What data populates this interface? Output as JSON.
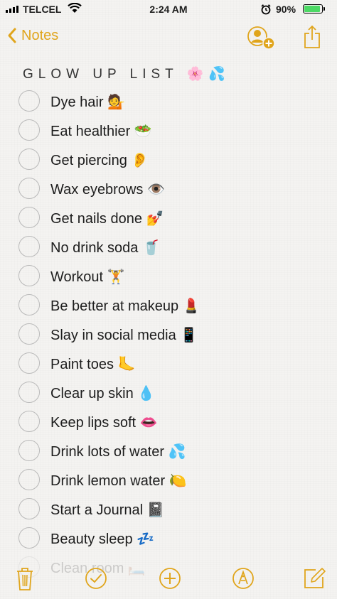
{
  "status_bar": {
    "carrier": "TELCEL",
    "time": "2:24 AM",
    "battery": "90%",
    "battery_level": 0.9
  },
  "nav": {
    "back_label": "Notes",
    "icons": [
      "chevron-left-icon",
      "add-people-icon",
      "share-icon"
    ]
  },
  "note": {
    "title": "GLOW UP LIST 🌸💦",
    "items": [
      {
        "text": "Dye hair 💁"
      },
      {
        "text": "Eat healthier 🥗"
      },
      {
        "text": "Get piercing 👂"
      },
      {
        "text": "Wax eyebrows 👁️"
      },
      {
        "text": "Get nails done 💅"
      },
      {
        "text": "No drink soda 🥤"
      },
      {
        "text": "Workout 🏋️"
      },
      {
        "text": "Be better at makeup 💄"
      },
      {
        "text": "Slay in social media 📱"
      },
      {
        "text": "Paint toes 🦶"
      },
      {
        "text": "Clear up skin 💧"
      },
      {
        "text": "Keep lips soft 👄"
      },
      {
        "text": "Drink lots of water 💦"
      },
      {
        "text": "Drink lemon water 🍋"
      },
      {
        "text": "Start a Journal 📓"
      },
      {
        "text": "Beauty sleep 💤"
      },
      {
        "text": "Clean room 🛏️"
      }
    ]
  },
  "toolbar": {
    "icons": [
      "trash-icon",
      "checklist-icon",
      "add-icon",
      "markup-icon",
      "compose-icon"
    ]
  },
  "colors": {
    "accent": "#e0a51c",
    "background": "#f4f3f1",
    "checkbox_border": "#b9b9b9",
    "battery_green": "#4cd964"
  }
}
